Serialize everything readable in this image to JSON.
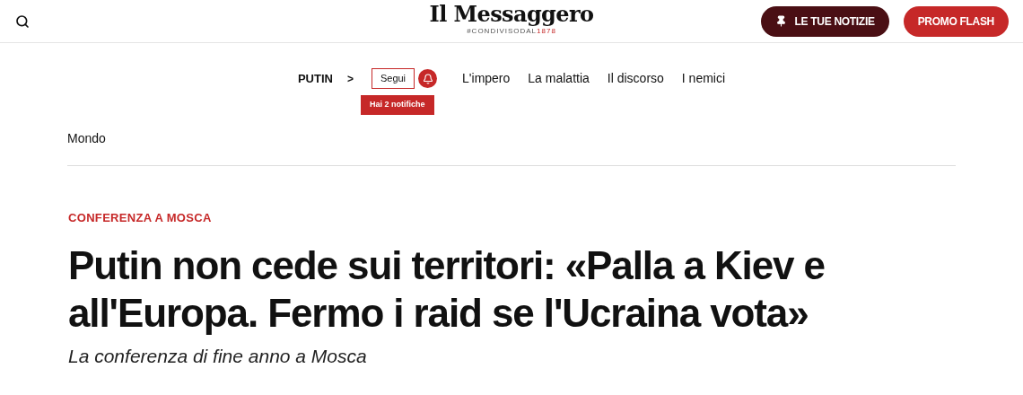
{
  "header": {
    "logo": "Il Messaggero",
    "tagline": "#CONDIVISODAL",
    "tagline_year": "1878",
    "buttons": [
      {
        "label": "LE TUE NOTIZIE",
        "kind": "dark"
      },
      {
        "label": "PROMO FLASH",
        "kind": "red"
      }
    ]
  },
  "topic_bar": {
    "topic": "PUTIN",
    "arrow": ">",
    "follow": "Segui",
    "notification_tip": "Hai 2 notifiche",
    "links": [
      "L'impero",
      "La malattia",
      "Il discorso",
      "I nemici"
    ]
  },
  "breadcrumb": "Mondo",
  "article": {
    "kicker": "CONFERENZA A MOSCA",
    "title": "Putin non cede sui territori: «Palla a Kiev e all'Europa. Fermo i raid se l'Ucraina vota»",
    "subtitle": "La conferenza di fine anno a Mosca"
  }
}
